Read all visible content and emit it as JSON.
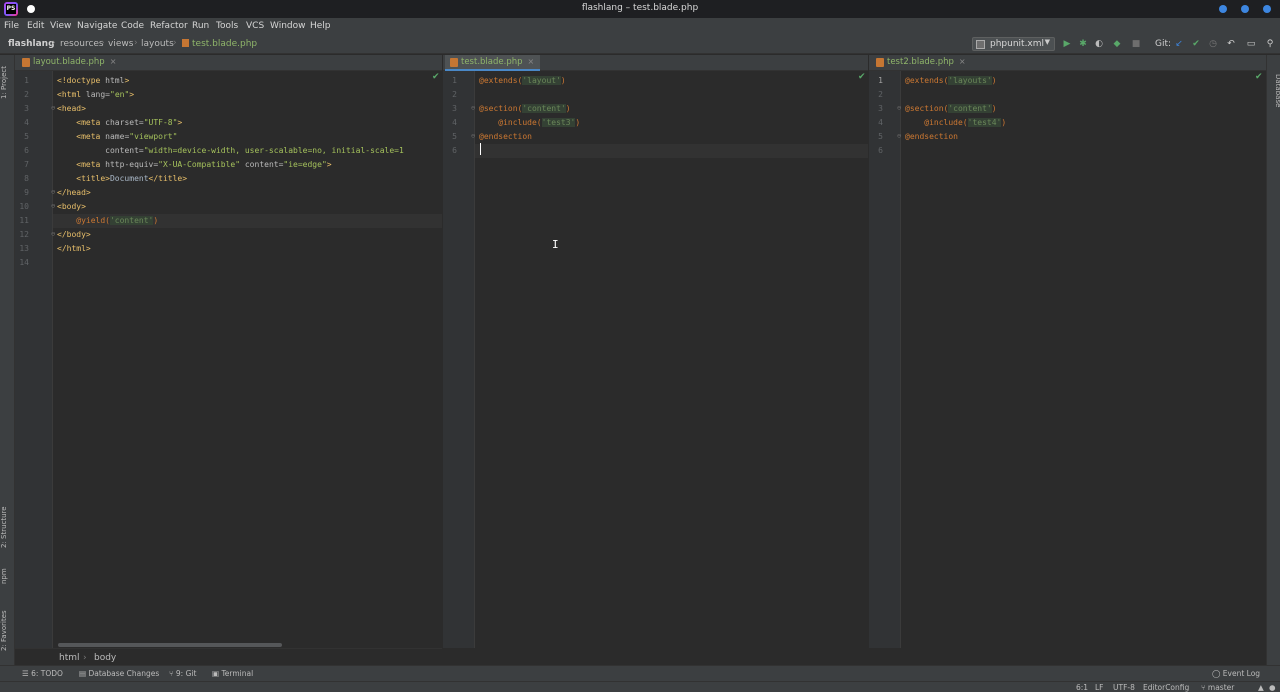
{
  "window": {
    "title": "flashlang – test.blade.php"
  },
  "menu": [
    "File",
    "Edit",
    "View",
    "Navigate",
    "Code",
    "Refactor",
    "Run",
    "Tools",
    "VCS",
    "Window",
    "Help"
  ],
  "breadcrumb": [
    "flashlang",
    "resources",
    "views",
    "layouts",
    "test.blade.php"
  ],
  "run_config": {
    "label": "phpunit.xml"
  },
  "git_label": "Git:",
  "left_tool_tabs": [
    "1: Project",
    "2: Structure",
    "npm",
    "2: Favorites"
  ],
  "right_tool_tabs": [
    "Database"
  ],
  "editors": [
    {
      "tab": "layout.blade.php",
      "line_numbers": [
        "1",
        "2",
        "3",
        "4",
        "5",
        "6",
        "7",
        "8",
        "9",
        "10",
        "11",
        "12",
        "13",
        "14"
      ],
      "lines": [
        [
          {
            "c": "tag",
            "t": "<!doctype "
          },
          {
            "c": "attr",
            "t": "html"
          },
          {
            "c": "tag",
            "t": ">"
          }
        ],
        [
          {
            "c": "tag",
            "t": "<html "
          },
          {
            "c": "attr",
            "t": "lang="
          },
          {
            "c": "str",
            "t": "\"en\""
          },
          {
            "c": "tag",
            "t": ">"
          }
        ],
        [
          {
            "c": "tag",
            "t": "<head>"
          }
        ],
        [
          {
            "c": "txt",
            "t": "    "
          },
          {
            "c": "tag",
            "t": "<meta "
          },
          {
            "c": "attr",
            "t": "charset="
          },
          {
            "c": "str",
            "t": "\"UTF-8\""
          },
          {
            "c": "tag",
            "t": ">"
          }
        ],
        [
          {
            "c": "txt",
            "t": "    "
          },
          {
            "c": "tag",
            "t": "<meta "
          },
          {
            "c": "attr",
            "t": "name="
          },
          {
            "c": "str",
            "t": "\"viewport\""
          }
        ],
        [
          {
            "c": "txt",
            "t": "          "
          },
          {
            "c": "attr",
            "t": "content="
          },
          {
            "c": "str",
            "t": "\"width=device-width, user-scalable=no, initial-scale=1"
          }
        ],
        [
          {
            "c": "txt",
            "t": "    "
          },
          {
            "c": "tag",
            "t": "<meta "
          },
          {
            "c": "attr",
            "t": "http-equiv="
          },
          {
            "c": "str",
            "t": "\"X-UA-Compatible\""
          },
          {
            "c": "attr",
            "t": " content="
          },
          {
            "c": "str",
            "t": "\"ie=edge\""
          },
          {
            "c": "tag",
            "t": ">"
          }
        ],
        [
          {
            "c": "txt",
            "t": "    "
          },
          {
            "c": "tag",
            "t": "<title>"
          },
          {
            "c": "txt",
            "t": "Document"
          },
          {
            "c": "tag",
            "t": "</title>"
          }
        ],
        [
          {
            "c": "tag",
            "t": "</head>"
          }
        ],
        [
          {
            "c": "tag",
            "t": "<body>"
          }
        ],
        [
          {
            "c": "txt",
            "t": "    "
          },
          {
            "c": "yield",
            "t": "@yield("
          },
          {
            "c": "bstr",
            "t": "'content'"
          },
          {
            "c": "yield",
            "t": ")"
          }
        ],
        [
          {
            "c": "tag",
            "t": "</body>"
          }
        ],
        [
          {
            "c": "tag",
            "t": "</html>"
          }
        ],
        []
      ]
    },
    {
      "tab": "test.blade.php",
      "line_numbers": [
        "1",
        "2",
        "3",
        "4",
        "5",
        "6"
      ],
      "lines": [
        [
          {
            "c": "dir",
            "t": "@extends("
          },
          {
            "c": "bstr",
            "t": "'layout'"
          },
          {
            "c": "dir",
            "t": ")"
          }
        ],
        [],
        [
          {
            "c": "dir",
            "t": "@section("
          },
          {
            "c": "bstr",
            "t": "'content'"
          },
          {
            "c": "dir",
            "t": ")"
          }
        ],
        [
          {
            "c": "txt",
            "t": "    "
          },
          {
            "c": "dir",
            "t": "@include("
          },
          {
            "c": "bstr",
            "t": "'test3'"
          },
          {
            "c": "dir",
            "t": ")"
          }
        ],
        [
          {
            "c": "dir",
            "t": "@endsection"
          }
        ],
        []
      ]
    },
    {
      "tab": "test2.blade.php",
      "line_numbers": [
        "1",
        "2",
        "3",
        "4",
        "5",
        "6"
      ],
      "lines": [
        [
          {
            "c": "dir",
            "t": "@extends("
          },
          {
            "c": "bstr",
            "t": "'layouts'"
          },
          {
            "c": "dir",
            "t": ")"
          }
        ],
        [],
        [
          {
            "c": "dir",
            "t": "@section("
          },
          {
            "c": "bstr",
            "t": "'content'"
          },
          {
            "c": "dir",
            "t": ")"
          }
        ],
        [
          {
            "c": "txt",
            "t": "    "
          },
          {
            "c": "dir",
            "t": "@include("
          },
          {
            "c": "bstr",
            "t": "'test4'"
          },
          {
            "c": "dir",
            "t": ")"
          }
        ],
        [
          {
            "c": "dir",
            "t": "@endsection"
          }
        ],
        []
      ]
    }
  ],
  "html_breadcrumb": [
    "html",
    "body"
  ],
  "bottom_tools": [
    "6: TODO",
    "Database Changes",
    "9: Git",
    "Terminal"
  ],
  "event_log": "Event Log",
  "status": {
    "position": "6:1",
    "line_ending": "LF",
    "encoding": "UTF-8",
    "editor_config": "EditorConfig",
    "branch": "master"
  }
}
